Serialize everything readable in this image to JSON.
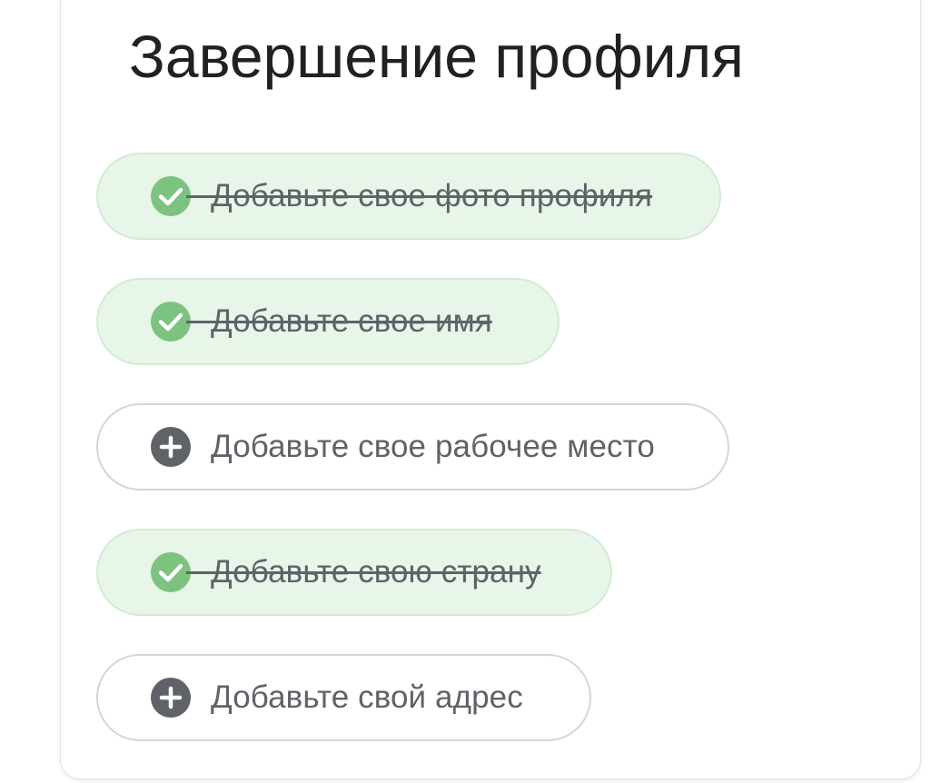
{
  "title": "Завершение профиля",
  "colors": {
    "done_bg": "#e8f5e9",
    "check": "#7cc37f",
    "plus": "#5f6368",
    "text": "#5f6368",
    "title": "#202124"
  },
  "tasks": [
    {
      "label": "Добавьте свое фото профиля",
      "completed": true,
      "icon": "check-circle-icon"
    },
    {
      "label": "Добавьте свое имя",
      "completed": true,
      "icon": "check-circle-icon"
    },
    {
      "label": "Добавьте свое рабочее место",
      "completed": false,
      "icon": "plus-circle-icon"
    },
    {
      "label": "Добавьте свою страну",
      "completed": true,
      "icon": "check-circle-icon"
    },
    {
      "label": "Добавьте свой адрес",
      "completed": false,
      "icon": "plus-circle-icon"
    }
  ]
}
